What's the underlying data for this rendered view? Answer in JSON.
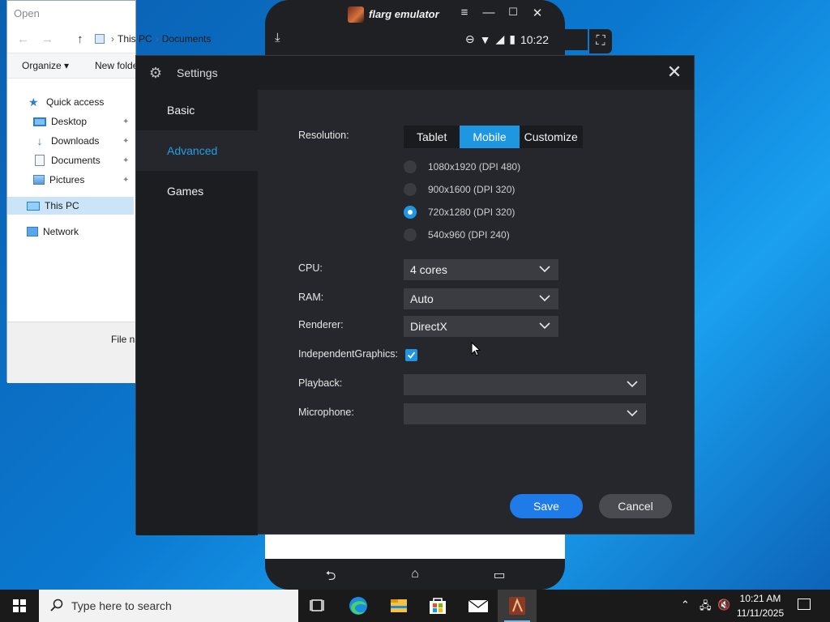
{
  "explorer": {
    "title": "Open",
    "breadcrumb": [
      "This PC",
      "Documents"
    ],
    "toolbar": {
      "organize": "Organize ▾",
      "new_folder": "New folde"
    },
    "tree": [
      {
        "label": "Quick access",
        "icon": "star-icon"
      },
      {
        "label": "Desktop",
        "icon": "desktop-folder-icon",
        "pinned": true
      },
      {
        "label": "Downloads",
        "icon": "downloads-folder-icon",
        "pinned": true
      },
      {
        "label": "Documents",
        "icon": "documents-folder-icon",
        "pinned": true
      },
      {
        "label": "Pictures",
        "icon": "pictures-folder-icon",
        "pinned": true
      },
      {
        "label": "This PC",
        "icon": "this-pc-icon",
        "selected": true
      },
      {
        "label": "Network",
        "icon": "network-icon"
      }
    ],
    "filename_label": "File n"
  },
  "emulator": {
    "app_name": "flarg emulator",
    "status_time": "10:22",
    "window_controls": [
      "menu",
      "minimize",
      "maximize",
      "close"
    ]
  },
  "settings": {
    "title": "Settings",
    "nav": [
      {
        "label": "Basic",
        "active": false
      },
      {
        "label": "Advanced",
        "active": true
      },
      {
        "label": "Games",
        "active": false
      }
    ],
    "resolution": {
      "label": "Resolution:",
      "modes": [
        {
          "label": "Tablet",
          "active": false
        },
        {
          "label": "Mobile",
          "active": true
        },
        {
          "label": "Customize",
          "active": false
        }
      ],
      "options": [
        {
          "label": "1080x1920 (DPI 480)",
          "selected": false
        },
        {
          "label": "900x1600 (DPI 320)",
          "selected": false
        },
        {
          "label": "720x1280 (DPI 320)",
          "selected": true
        },
        {
          "label": "540x960 (DPI 240)",
          "selected": false
        }
      ]
    },
    "cpu": {
      "label": "CPU:",
      "value": "4 cores"
    },
    "ram": {
      "label": "RAM:",
      "value": "Auto"
    },
    "renderer": {
      "label": "Renderer:",
      "value": "DirectX"
    },
    "independent_graphics": {
      "label": "IndependentGraphics:",
      "checked": true
    },
    "playback": {
      "label": "Playback:",
      "value": ""
    },
    "microphone": {
      "label": "Microphone:",
      "value": ""
    },
    "save_label": "Save",
    "cancel_label": "Cancel",
    "accent_color": "#1e96e0"
  },
  "taskbar": {
    "search_placeholder": "Type here to search",
    "apps": [
      "task-view-icon",
      "edge-icon",
      "file-explorer-icon",
      "store-icon",
      "mail-icon",
      "flarg-emulator-icon"
    ],
    "time": "10:21 AM",
    "date": "11/11/2025"
  }
}
